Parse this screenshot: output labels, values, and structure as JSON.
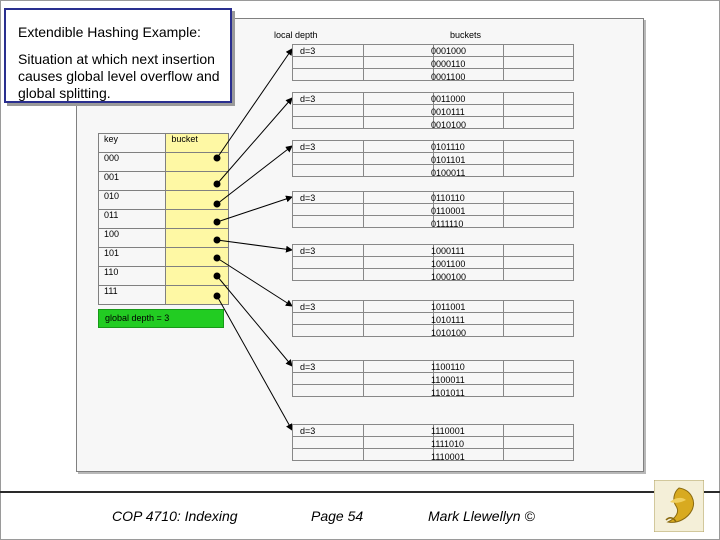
{
  "title": "Extendible Hashing Example:",
  "description": "Situation at which next insertion causes global level overflow and global splitting.",
  "headers": {
    "local_depth": "local depth",
    "buckets": "buckets"
  },
  "directory": {
    "key_header": "key",
    "bucket_header": "bucket",
    "keys": [
      "000",
      "001",
      "010",
      "011",
      "100",
      "101",
      "110",
      "111"
    ],
    "global_depth": "global depth = 3"
  },
  "buckets": [
    {
      "local_depth": "d=3",
      "values": [
        "0001000",
        "0000110",
        "0001100"
      ]
    },
    {
      "local_depth": "d=3",
      "values": [
        "0011000",
        "0010111",
        "0010100"
      ]
    },
    {
      "local_depth": "d=3",
      "values": [
        "0101110",
        "0101101",
        "0100011"
      ]
    },
    {
      "local_depth": "d=3",
      "values": [
        "0110110",
        "0110001",
        "0111110"
      ]
    },
    {
      "local_depth": "d=3",
      "values": [
        "1000111",
        "1001100",
        "1000100"
      ]
    },
    {
      "local_depth": "d=3",
      "values": [
        "1011001",
        "1010111",
        "1010100"
      ]
    },
    {
      "local_depth": "d=3",
      "values": [
        "1100110",
        "1100011",
        "1101011"
      ]
    },
    {
      "local_depth": "d=3",
      "values": [
        "1110001",
        "1111010",
        "1110001"
      ]
    }
  ],
  "footer": {
    "course": "COP 4710: Indexing",
    "page": "Page 54",
    "author": "Mark Llewellyn ©"
  },
  "colors": {
    "title_border": "#2a2f8f",
    "bucket_header": "#f9c000",
    "pointer_cells": "#fef8a4",
    "global_depth_box": "#22cc22"
  }
}
